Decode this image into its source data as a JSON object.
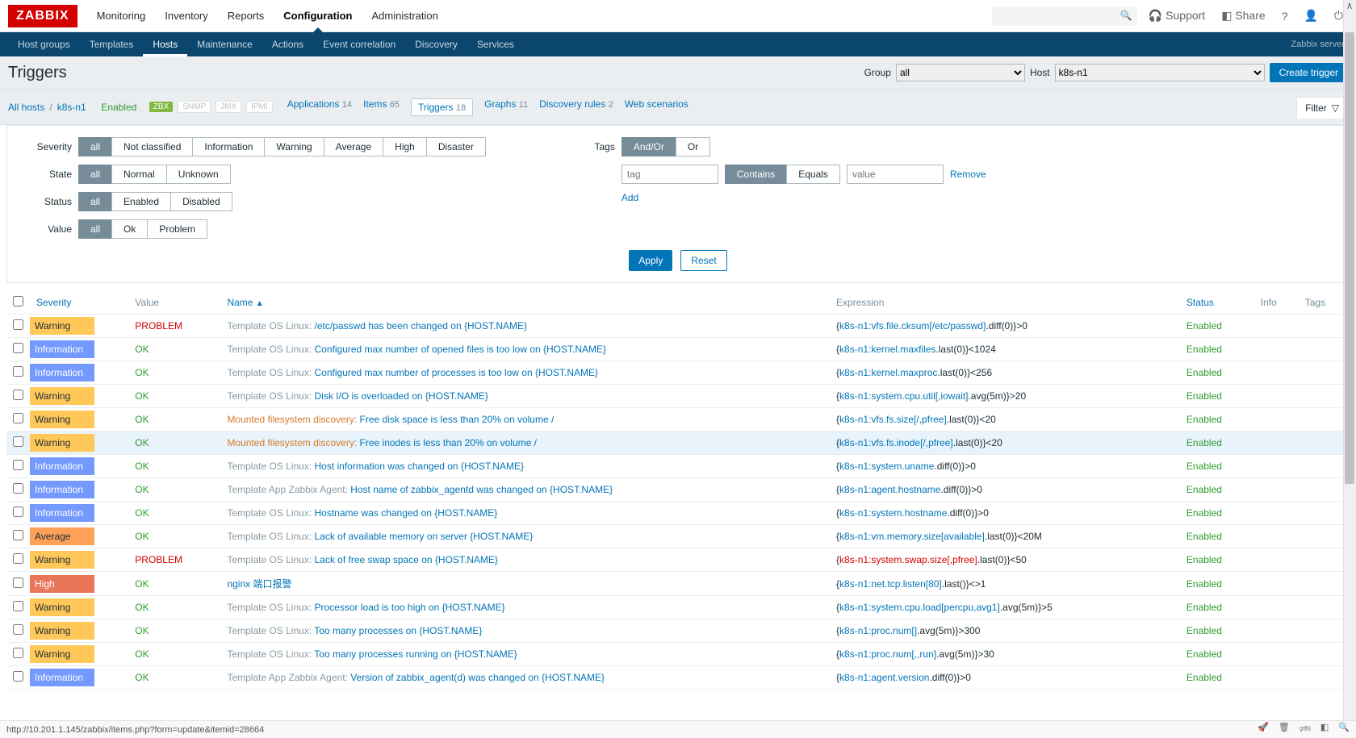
{
  "logo": "ZABBIX",
  "topnav": [
    "Monitoring",
    "Inventory",
    "Reports",
    "Configuration",
    "Administration"
  ],
  "topnav_active": 3,
  "top_right": {
    "support": "Support",
    "share": "Share"
  },
  "subnav": [
    "Host groups",
    "Templates",
    "Hosts",
    "Maintenance",
    "Actions",
    "Event correlation",
    "Discovery",
    "Services"
  ],
  "subnav_active": 2,
  "subnav_right": "Zabbix server",
  "page_title": "Triggers",
  "group_label": "Group",
  "group_value": "all",
  "host_label": "Host",
  "host_value": "k8s-n1",
  "create_btn": "Create trigger",
  "breadcrumb": {
    "all_hosts": "All hosts",
    "host": "k8s-n1",
    "enabled": "Enabled",
    "zbx": "ZBX",
    "snmp": "SNMP",
    "jmx": "JMX",
    "ipmi": "IPMI"
  },
  "bc_tabs": [
    {
      "label": "Applications",
      "count": "14"
    },
    {
      "label": "Items",
      "count": "65"
    },
    {
      "label": "Triggers",
      "count": "18"
    },
    {
      "label": "Graphs",
      "count": "11"
    },
    {
      "label": "Discovery rules",
      "count": "2"
    },
    {
      "label": "Web scenarios",
      "count": ""
    }
  ],
  "bc_active_tab": 2,
  "filter_label": "Filter",
  "filters": {
    "severity_label": "Severity",
    "severity": [
      "all",
      "Not classified",
      "Information",
      "Warning",
      "Average",
      "High",
      "Disaster"
    ],
    "state_label": "State",
    "state": [
      "all",
      "Normal",
      "Unknown"
    ],
    "status_label": "Status",
    "status": [
      "all",
      "Enabled",
      "Disabled"
    ],
    "value_label": "Value",
    "value": [
      "all",
      "Ok",
      "Problem"
    ],
    "tags_label": "Tags",
    "tags_mode": [
      "And/Or",
      "Or"
    ],
    "tag_placeholder": "tag",
    "contains": [
      "Contains",
      "Equals"
    ],
    "value_placeholder": "value",
    "remove": "Remove",
    "add": "Add",
    "apply": "Apply",
    "reset": "Reset"
  },
  "headers": {
    "severity": "Severity",
    "value": "Value",
    "name": "Name",
    "expression": "Expression",
    "status": "Status",
    "info": "Info",
    "tags": "Tags"
  },
  "rows": [
    {
      "sev": "Warning",
      "sevClass": "sev-warning",
      "val": "PROBLEM",
      "tmpl": "Template OS Linux",
      "tmplClass": "tmpl",
      "name": "/etc/passwd has been changed on {HOST.NAME}",
      "expr_pre": "{",
      "expr_link": "k8s-n1:vfs.file.cksum[/etc/passwd]",
      "expr_post": ".diff(0)}>0",
      "status": "Enabled"
    },
    {
      "sev": "Information",
      "sevClass": "sev-information",
      "val": "OK",
      "tmpl": "Template OS Linux",
      "tmplClass": "tmpl",
      "name": "Configured max number of opened files is too low on {HOST.NAME}",
      "expr_pre": "{",
      "expr_link": "k8s-n1:kernel.maxfiles",
      "expr_post": ".last(0)}<1024",
      "status": "Enabled"
    },
    {
      "sev": "Information",
      "sevClass": "sev-information",
      "val": "OK",
      "tmpl": "Template OS Linux",
      "tmplClass": "tmpl",
      "name": "Configured max number of processes is too low on {HOST.NAME}",
      "expr_pre": "{",
      "expr_link": "k8s-n1:kernel.maxproc",
      "expr_post": ".last(0)}<256",
      "status": "Enabled"
    },
    {
      "sev": "Warning",
      "sevClass": "sev-warning",
      "val": "OK",
      "tmpl": "Template OS Linux",
      "tmplClass": "tmpl",
      "name": "Disk I/O is overloaded on {HOST.NAME}",
      "expr_pre": "{",
      "expr_link": "k8s-n1:system.cpu.util[,iowait]",
      "expr_post": ".avg(5m)}>20",
      "status": "Enabled"
    },
    {
      "sev": "Warning",
      "sevClass": "sev-warning",
      "val": "OK",
      "tmpl": "Mounted filesystem discovery",
      "tmplClass": "tmpl-orange",
      "name": "Free disk space is less than 20% on volume /",
      "expr_pre": "{",
      "expr_link": "k8s-n1:vfs.fs.size[/,pfree]",
      "expr_post": ".last(0)}<20",
      "status": "Enabled"
    },
    {
      "sev": "Warning",
      "sevClass": "sev-warning",
      "val": "OK",
      "tmpl": "Mounted filesystem discovery",
      "tmplClass": "tmpl-orange",
      "name": "Free inodes is less than 20% on volume /",
      "expr_pre": "{",
      "expr_link": "k8s-n1:vfs.fs.inode[/,pfree]",
      "expr_post": ".last(0)}<20",
      "status": "Enabled",
      "hover": true
    },
    {
      "sev": "Information",
      "sevClass": "sev-information",
      "val": "OK",
      "tmpl": "Template OS Linux",
      "tmplClass": "tmpl",
      "name": "Host information was changed on {HOST.NAME}",
      "expr_pre": "{",
      "expr_link": "k8s-n1:system.uname",
      "expr_post": ".diff(0)}>0",
      "status": "Enabled"
    },
    {
      "sev": "Information",
      "sevClass": "sev-information",
      "val": "OK",
      "tmpl": "Template App Zabbix Agent",
      "tmplClass": "tmpl",
      "name": "Host name of zabbix_agentd was changed on {HOST.NAME}",
      "expr_pre": "{",
      "expr_link": "k8s-n1:agent.hostname",
      "expr_post": ".diff(0)}>0",
      "status": "Enabled"
    },
    {
      "sev": "Information",
      "sevClass": "sev-information",
      "val": "OK",
      "tmpl": "Template OS Linux",
      "tmplClass": "tmpl",
      "name": "Hostname was changed on {HOST.NAME}",
      "expr_pre": "{",
      "expr_link": "k8s-n1:system.hostname",
      "expr_post": ".diff(0)}>0",
      "status": "Enabled"
    },
    {
      "sev": "Average",
      "sevClass": "sev-average",
      "val": "OK",
      "tmpl": "Template OS Linux",
      "tmplClass": "tmpl",
      "name": "Lack of available memory on server {HOST.NAME}",
      "expr_pre": "{",
      "expr_link": "k8s-n1:vm.memory.size[available]",
      "expr_post": ".last(0)}<20M",
      "status": "Enabled"
    },
    {
      "sev": "Warning",
      "sevClass": "sev-warning",
      "val": "PROBLEM",
      "tmpl": "Template OS Linux",
      "tmplClass": "tmpl",
      "name": "Lack of free swap space on {HOST.NAME}",
      "expr_pre": "{",
      "expr_link": "k8s-n1:system.swap.size[,pfree]",
      "expr_linkClass": "expr-red",
      "expr_post": ".last(0)}<50",
      "status": "Enabled"
    },
    {
      "sev": "High",
      "sevClass": "sev-high",
      "val": "OK",
      "tmpl": "",
      "tmplClass": "",
      "name": "nginx 端口报警",
      "expr_pre": "{",
      "expr_link": "k8s-n1:net.tcp.listen[80]",
      "expr_post": ".last()}<>1",
      "status": "Enabled"
    },
    {
      "sev": "Warning",
      "sevClass": "sev-warning",
      "val": "OK",
      "tmpl": "Template OS Linux",
      "tmplClass": "tmpl",
      "name": "Processor load is too high on {HOST.NAME}",
      "expr_pre": "{",
      "expr_link": "k8s-n1:system.cpu.load[percpu,avg1]",
      "expr_post": ".avg(5m)}>5",
      "status": "Enabled"
    },
    {
      "sev": "Warning",
      "sevClass": "sev-warning",
      "val": "OK",
      "tmpl": "Template OS Linux",
      "tmplClass": "tmpl",
      "name": "Too many processes on {HOST.NAME}",
      "expr_pre": "{",
      "expr_link": "k8s-n1:proc.num[]",
      "expr_post": ".avg(5m)}>300",
      "status": "Enabled"
    },
    {
      "sev": "Warning",
      "sevClass": "sev-warning",
      "val": "OK",
      "tmpl": "Template OS Linux",
      "tmplClass": "tmpl",
      "name": "Too many processes running on {HOST.NAME}",
      "expr_pre": "{",
      "expr_link": "k8s-n1:proc.num[,,run]",
      "expr_post": ".avg(5m)}>30",
      "status": "Enabled"
    },
    {
      "sev": "Information",
      "sevClass": "sev-information",
      "val": "OK",
      "tmpl": "Template App Zabbix Agent",
      "tmplClass": "tmpl",
      "name": "Version of zabbix_agent(d) was changed on {HOST.NAME}",
      "expr_pre": "{",
      "expr_link": "k8s-n1:agent.version",
      "expr_post": ".diff(0)}>0",
      "status": "Enabled"
    }
  ],
  "footer_url": "http://10.201.1.145/zabbix/items.php?form=update&itemid=28664"
}
